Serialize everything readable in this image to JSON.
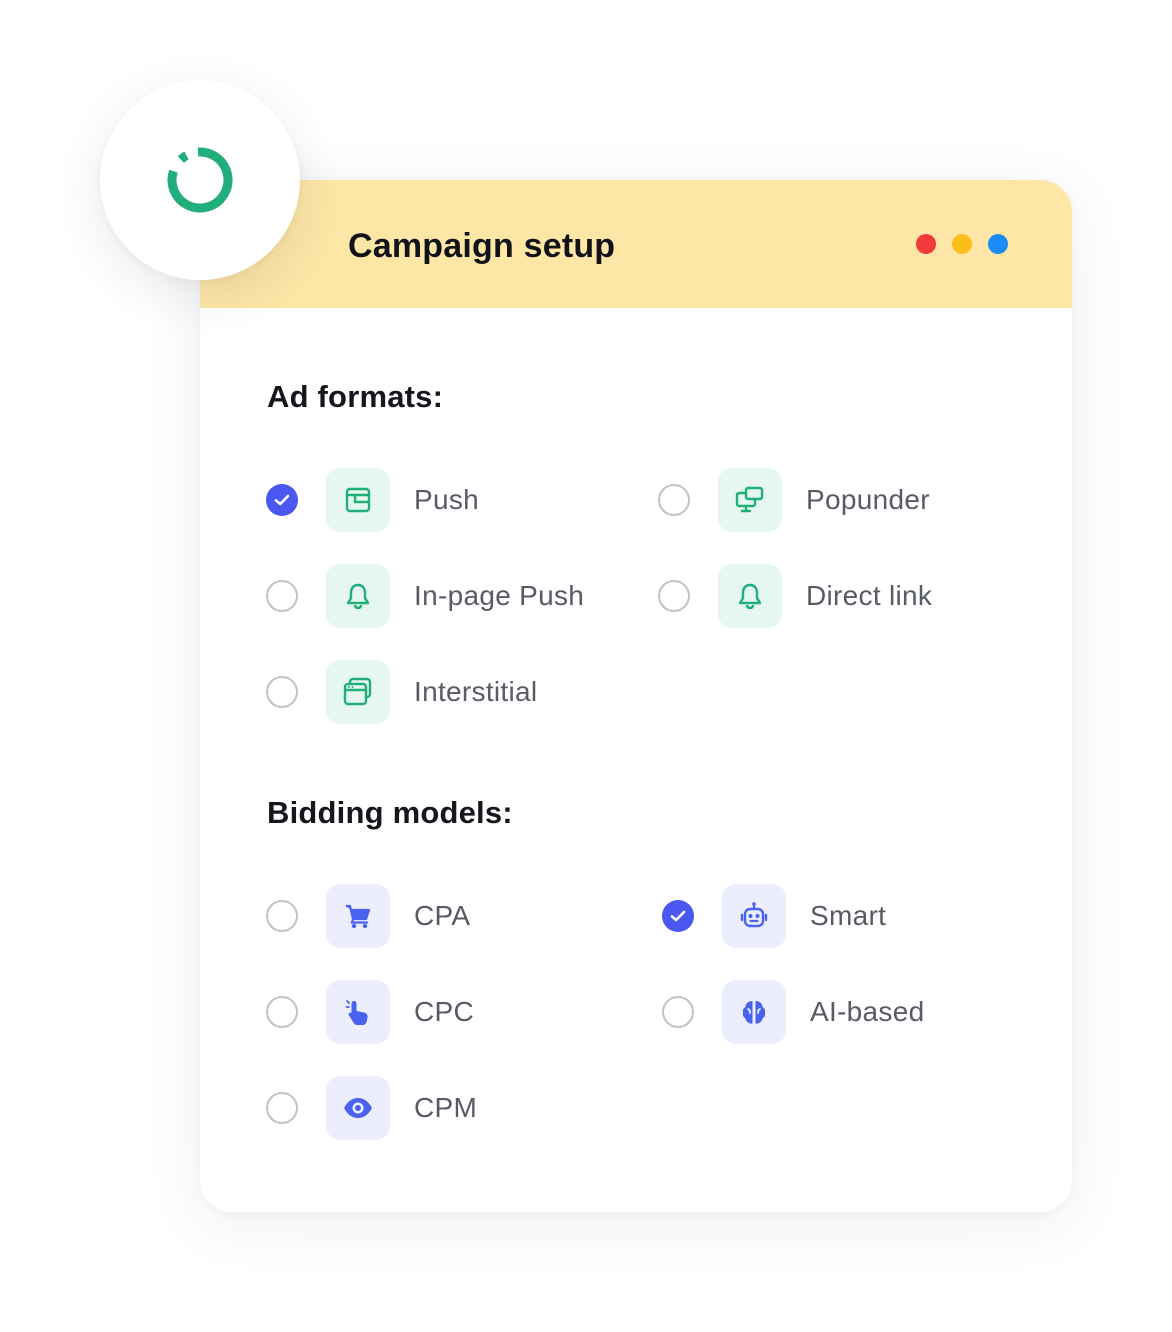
{
  "window": {
    "title": "Campaign setup",
    "dot_colors": [
      "#f23a3a",
      "#fbbd18",
      "#1b8cf5"
    ]
  },
  "colors": {
    "header_bg": "#fde6a6",
    "accent_green": "#20ae7a",
    "accent_blue": "#4a63ef",
    "checked_radio": "#4a57f0"
  },
  "ad_formats": {
    "title": "Ad formats:",
    "options": [
      {
        "label": "Push",
        "icon": "window-icon",
        "checked": true
      },
      {
        "label": "Popunder",
        "icon": "monitor-stack-icon",
        "checked": false
      },
      {
        "label": "In-page Push",
        "icon": "bell-icon",
        "checked": false
      },
      {
        "label": "Direct link",
        "icon": "bell-icon",
        "checked": false
      },
      {
        "label": "Interstitial",
        "icon": "browser-windows-icon",
        "checked": false
      }
    ]
  },
  "bidding_models": {
    "title": "Bidding models:",
    "options": [
      {
        "label": "CPA",
        "icon": "cart-icon",
        "checked": false
      },
      {
        "label": "Smart",
        "icon": "robot-icon",
        "checked": true
      },
      {
        "label": "CPC",
        "icon": "pointer-hand-icon",
        "checked": false
      },
      {
        "label": "AI-based",
        "icon": "brain-icon",
        "checked": false
      },
      {
        "label": "CPM",
        "icon": "eye-icon",
        "checked": false
      }
    ]
  }
}
